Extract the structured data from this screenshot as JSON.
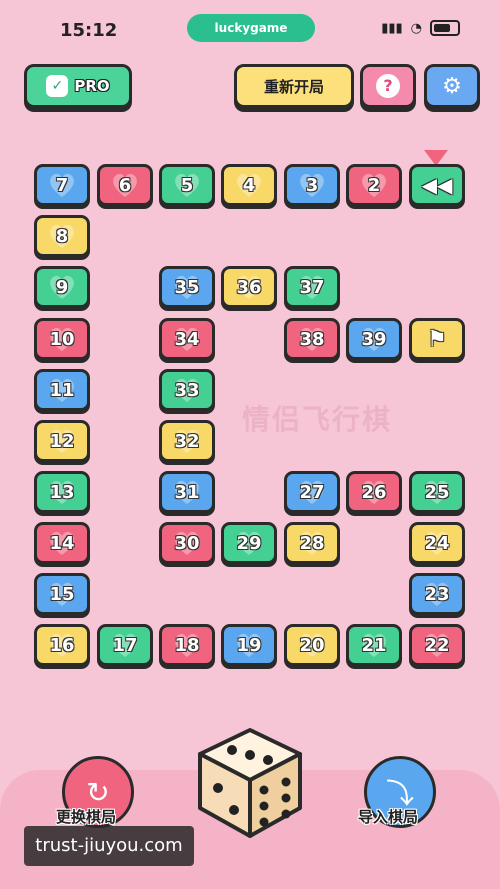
{
  "status_bar": {
    "time": "15:12",
    "app_pill": "luckygame"
  },
  "header": {
    "pro_label": "PRO",
    "reset_label": "重新开局"
  },
  "colors": {
    "blue": "#5aa7ef",
    "red": "#f0647f",
    "green": "#44cf93",
    "yellow": "#f8d866"
  },
  "board": {
    "tiles": [
      {
        "n": "7",
        "color": "blue"
      },
      {
        "n": "6",
        "color": "red"
      },
      {
        "n": "5",
        "color": "green"
      },
      {
        "n": "4",
        "color": "yellow"
      },
      {
        "n": "3",
        "color": "blue"
      },
      {
        "n": "2",
        "color": "red"
      },
      {
        "n": "start",
        "color": "green",
        "icon": "start-icon"
      },
      {
        "n": "8",
        "color": "yellow"
      },
      {
        "n": "9",
        "color": "green"
      },
      {
        "n": "10",
        "color": "red"
      },
      {
        "n": "11",
        "color": "blue"
      },
      {
        "n": "12",
        "color": "yellow"
      },
      {
        "n": "13",
        "color": "green"
      },
      {
        "n": "14",
        "color": "red"
      },
      {
        "n": "15",
        "color": "blue"
      },
      {
        "n": "16",
        "color": "yellow"
      },
      {
        "n": "17",
        "color": "green"
      },
      {
        "n": "18",
        "color": "red"
      },
      {
        "n": "19",
        "color": "blue"
      },
      {
        "n": "20",
        "color": "yellow"
      },
      {
        "n": "21",
        "color": "green"
      },
      {
        "n": "22",
        "color": "red"
      },
      {
        "n": "23",
        "color": "blue"
      },
      {
        "n": "24",
        "color": "yellow"
      },
      {
        "n": "25",
        "color": "green"
      },
      {
        "n": "26",
        "color": "red"
      },
      {
        "n": "27",
        "color": "blue"
      },
      {
        "n": "28",
        "color": "yellow"
      },
      {
        "n": "29",
        "color": "green"
      },
      {
        "n": "30",
        "color": "red"
      },
      {
        "n": "31",
        "color": "blue"
      },
      {
        "n": "32",
        "color": "yellow"
      },
      {
        "n": "33",
        "color": "green"
      },
      {
        "n": "34",
        "color": "red"
      },
      {
        "n": "35",
        "color": "blue"
      },
      {
        "n": "36",
        "color": "yellow"
      },
      {
        "n": "37",
        "color": "green"
      },
      {
        "n": "38",
        "color": "red"
      },
      {
        "n": "39",
        "color": "blue"
      },
      {
        "n": "finish",
        "color": "yellow",
        "icon": "finish-flag-icon"
      }
    ]
  },
  "board_watermark": "情侣飞行棋",
  "footer": {
    "change_label": "更换棋局",
    "import_label": "导入棋局"
  },
  "watermark": "trust-jiuyou.com"
}
